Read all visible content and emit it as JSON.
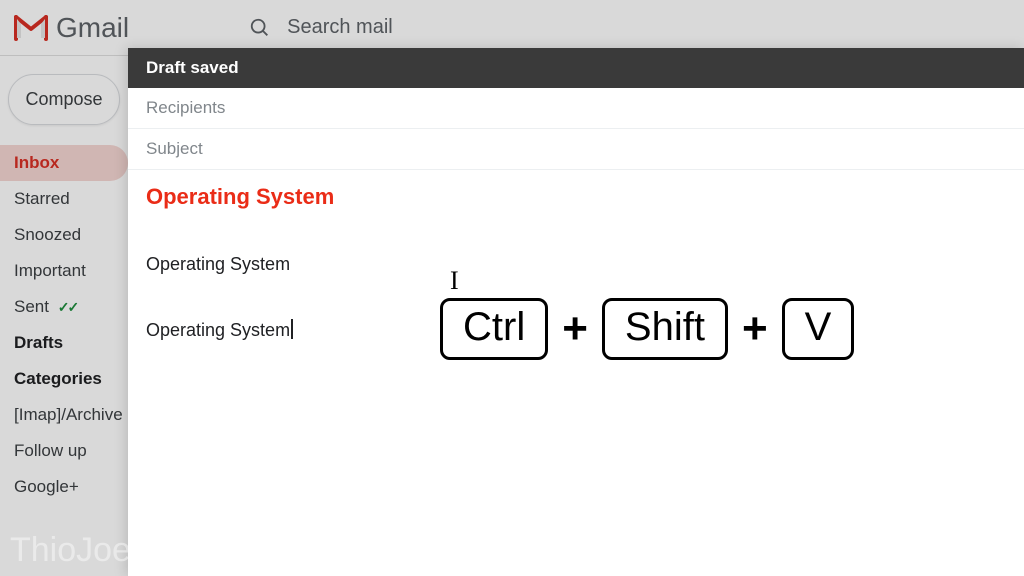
{
  "header": {
    "app_name": "Gmail",
    "search_placeholder": "Search mail"
  },
  "sidebar": {
    "compose": "Compose",
    "items": [
      {
        "label": "Inbox",
        "active": true
      },
      {
        "label": "Starred"
      },
      {
        "label": "Snoozed"
      },
      {
        "label": "Important"
      },
      {
        "label": "Sent",
        "sent": true
      },
      {
        "label": "Drafts",
        "bold": true
      },
      {
        "label": "Categories",
        "bold": true
      },
      {
        "label": "[Imap]/Archive"
      },
      {
        "label": "Follow up"
      },
      {
        "label": "Google+"
      }
    ]
  },
  "compose": {
    "title": "Draft saved",
    "recipients_placeholder": "Recipients",
    "subject_placeholder": "Subject",
    "body_line1": "Operating System",
    "body_line2": "Operating System",
    "body_line3": "Operating System"
  },
  "shortcut": {
    "key1": "Ctrl",
    "plus": "+",
    "key2": "Shift",
    "key3": "V"
  },
  "watermark": "ThioJoe"
}
